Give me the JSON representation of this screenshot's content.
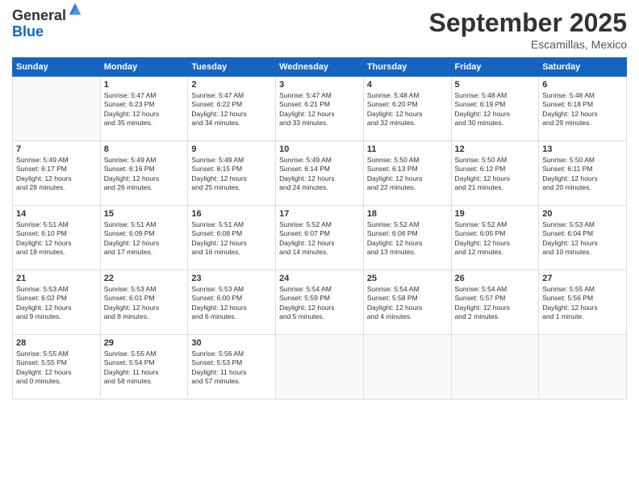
{
  "logo": {
    "general": "General",
    "blue": "Blue"
  },
  "title": "September 2025",
  "location": "Escamillas, Mexico",
  "days_header": [
    "Sunday",
    "Monday",
    "Tuesday",
    "Wednesday",
    "Thursday",
    "Friday",
    "Saturday"
  ],
  "weeks": [
    [
      {
        "day": "",
        "content": ""
      },
      {
        "day": "1",
        "content": "Sunrise: 5:47 AM\nSunset: 6:23 PM\nDaylight: 12 hours\nand 35 minutes."
      },
      {
        "day": "2",
        "content": "Sunrise: 5:47 AM\nSunset: 6:22 PM\nDaylight: 12 hours\nand 34 minutes."
      },
      {
        "day": "3",
        "content": "Sunrise: 5:47 AM\nSunset: 6:21 PM\nDaylight: 12 hours\nand 33 minutes."
      },
      {
        "day": "4",
        "content": "Sunrise: 5:48 AM\nSunset: 6:20 PM\nDaylight: 12 hours\nand 32 minutes."
      },
      {
        "day": "5",
        "content": "Sunrise: 5:48 AM\nSunset: 6:19 PM\nDaylight: 12 hours\nand 30 minutes."
      },
      {
        "day": "6",
        "content": "Sunrise: 5:48 AM\nSunset: 6:18 PM\nDaylight: 12 hours\nand 29 minutes."
      }
    ],
    [
      {
        "day": "7",
        "content": "Sunrise: 5:49 AM\nSunset: 6:17 PM\nDaylight: 12 hours\nand 28 minutes."
      },
      {
        "day": "8",
        "content": "Sunrise: 5:49 AM\nSunset: 6:16 PM\nDaylight: 12 hours\nand 26 minutes."
      },
      {
        "day": "9",
        "content": "Sunrise: 5:49 AM\nSunset: 6:15 PM\nDaylight: 12 hours\nand 25 minutes."
      },
      {
        "day": "10",
        "content": "Sunrise: 5:49 AM\nSunset: 6:14 PM\nDaylight: 12 hours\nand 24 minutes."
      },
      {
        "day": "11",
        "content": "Sunrise: 5:50 AM\nSunset: 6:13 PM\nDaylight: 12 hours\nand 22 minutes."
      },
      {
        "day": "12",
        "content": "Sunrise: 5:50 AM\nSunset: 6:12 PM\nDaylight: 12 hours\nand 21 minutes."
      },
      {
        "day": "13",
        "content": "Sunrise: 5:50 AM\nSunset: 6:11 PM\nDaylight: 12 hours\nand 20 minutes."
      }
    ],
    [
      {
        "day": "14",
        "content": "Sunrise: 5:51 AM\nSunset: 6:10 PM\nDaylight: 12 hours\nand 18 minutes."
      },
      {
        "day": "15",
        "content": "Sunrise: 5:51 AM\nSunset: 6:09 PM\nDaylight: 12 hours\nand 17 minutes."
      },
      {
        "day": "16",
        "content": "Sunrise: 5:51 AM\nSunset: 6:08 PM\nDaylight: 12 hours\nand 16 minutes."
      },
      {
        "day": "17",
        "content": "Sunrise: 5:52 AM\nSunset: 6:07 PM\nDaylight: 12 hours\nand 14 minutes."
      },
      {
        "day": "18",
        "content": "Sunrise: 5:52 AM\nSunset: 6:06 PM\nDaylight: 12 hours\nand 13 minutes."
      },
      {
        "day": "19",
        "content": "Sunrise: 5:52 AM\nSunset: 6:05 PM\nDaylight: 12 hours\nand 12 minutes."
      },
      {
        "day": "20",
        "content": "Sunrise: 5:53 AM\nSunset: 6:04 PM\nDaylight: 12 hours\nand 10 minutes."
      }
    ],
    [
      {
        "day": "21",
        "content": "Sunrise: 5:53 AM\nSunset: 6:02 PM\nDaylight: 12 hours\nand 9 minutes."
      },
      {
        "day": "22",
        "content": "Sunrise: 5:53 AM\nSunset: 6:01 PM\nDaylight: 12 hours\nand 8 minutes."
      },
      {
        "day": "23",
        "content": "Sunrise: 5:53 AM\nSunset: 6:00 PM\nDaylight: 12 hours\nand 6 minutes."
      },
      {
        "day": "24",
        "content": "Sunrise: 5:54 AM\nSunset: 5:59 PM\nDaylight: 12 hours\nand 5 minutes."
      },
      {
        "day": "25",
        "content": "Sunrise: 5:54 AM\nSunset: 5:58 PM\nDaylight: 12 hours\nand 4 minutes."
      },
      {
        "day": "26",
        "content": "Sunrise: 5:54 AM\nSunset: 5:57 PM\nDaylight: 12 hours\nand 2 minutes."
      },
      {
        "day": "27",
        "content": "Sunrise: 5:55 AM\nSunset: 5:56 PM\nDaylight: 12 hours\nand 1 minute."
      }
    ],
    [
      {
        "day": "28",
        "content": "Sunrise: 5:55 AM\nSunset: 5:55 PM\nDaylight: 12 hours\nand 0 minutes."
      },
      {
        "day": "29",
        "content": "Sunrise: 5:55 AM\nSunset: 5:54 PM\nDaylight: 11 hours\nand 58 minutes."
      },
      {
        "day": "30",
        "content": "Sunrise: 5:56 AM\nSunset: 5:53 PM\nDaylight: 11 hours\nand 57 minutes."
      },
      {
        "day": "",
        "content": ""
      },
      {
        "day": "",
        "content": ""
      },
      {
        "day": "",
        "content": ""
      },
      {
        "day": "",
        "content": ""
      }
    ]
  ]
}
